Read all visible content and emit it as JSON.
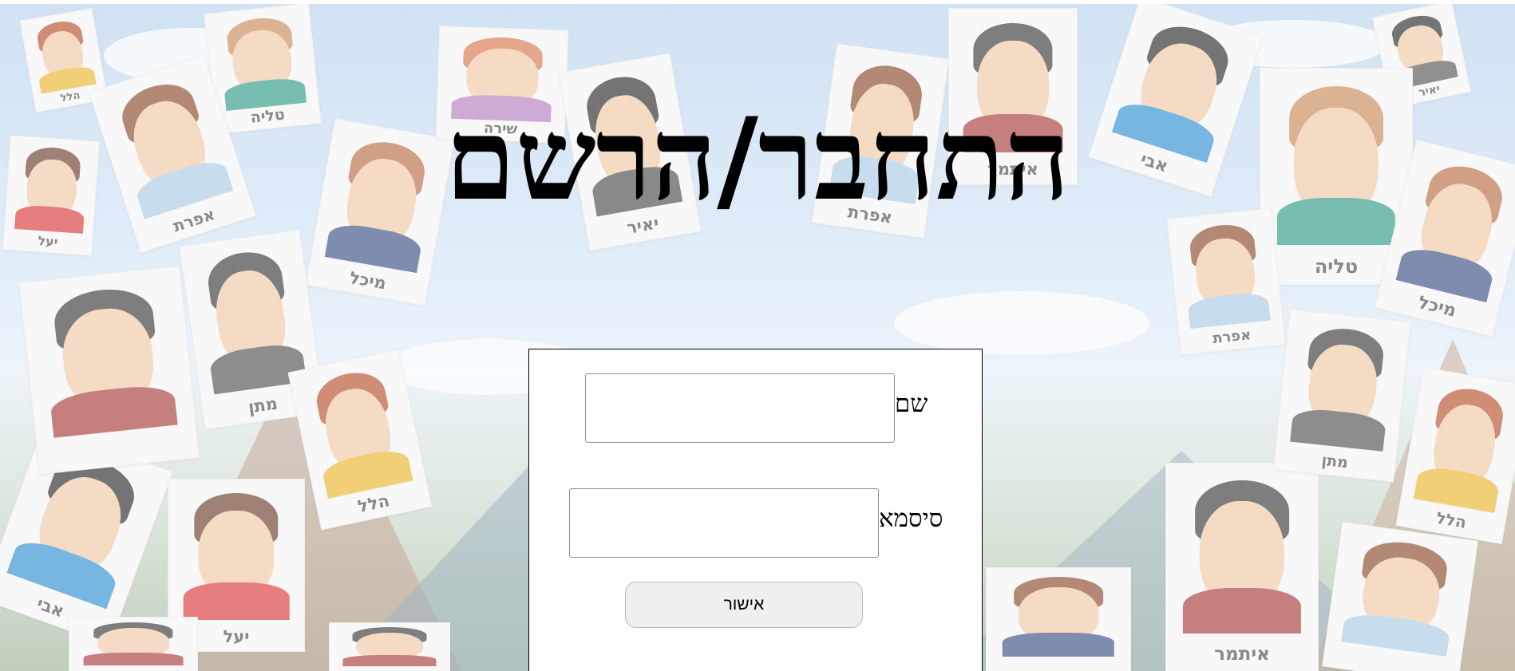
{
  "page": {
    "title": "התחבר/הרשם"
  },
  "form": {
    "name_label": "שם",
    "name_value": "",
    "password_label": "סיסמא",
    "password_value": "",
    "submit_label": "אישור"
  },
  "background": {
    "cards": [
      {
        "name": "הלל",
        "hair": "#b5512d",
        "shirt": "#e8b52f"
      },
      {
        "name": "טליה",
        "hair": "#c88a5a",
        "shirt": "#2e9a86"
      },
      {
        "name": "יעל",
        "hair": "#6b3e2a",
        "shirt": "#d9383a"
      },
      {
        "name": "אפרת",
        "hair": "#8a4b2b",
        "shirt": "#a9c9e3"
      },
      {
        "name": "מיכל",
        "hair": "#b86b45",
        "shirt": "#3a4f86"
      },
      {
        "name": "שירה",
        "hair": "#d9774e",
        "shirt": "#b27fbf"
      },
      {
        "name": "יאיר",
        "hair": "#2a2a2a",
        "shirt": "#4a4a4a"
      },
      {
        "name": "אפרת",
        "hair": "#8a4b2b",
        "shirt": "#a9c9e3"
      },
      {
        "name": "איתמר",
        "hair": "#3a3a3a",
        "shirt": "#a83b3b"
      },
      {
        "name": "אבי",
        "hair": "#2a2a2a",
        "shirt": "#2f8fd0"
      },
      {
        "name": "יאיר",
        "hair": "#2a2a2a",
        "shirt": "#555555"
      },
      {
        "name": "טליה",
        "hair": "#c88a5a",
        "shirt": "#2e9a86"
      },
      {
        "name": "מיכל",
        "hair": "#b86b45",
        "shirt": "#3a4f86"
      },
      {
        "name": "אפרת",
        "hair": "#8a4b2b",
        "shirt": "#a9c9e3"
      },
      {
        "name": "מתן",
        "hair": "#3a3a3a",
        "shirt": "#505050"
      },
      {
        "name": "הלל",
        "hair": "#b5512d",
        "shirt": "#e8b52f"
      },
      {
        "name": "איתמר",
        "hair": "#3a3a3a",
        "shirt": "#a83b3b"
      },
      {
        "name": "מתן",
        "hair": "#3a3a3a",
        "shirt": "#505050"
      },
      {
        "name": "הלל",
        "hair": "#b5512d",
        "shirt": "#e8b52f"
      },
      {
        "name": "אבי",
        "hair": "#2a2a2a",
        "shirt": "#2f8fd0"
      },
      {
        "name": "יעל",
        "hair": "#6b3e2a",
        "shirt": "#d9383a"
      },
      {
        "name": "",
        "hair": "#3a3a3a",
        "shirt": "#a83b3b"
      },
      {
        "name": "",
        "hair": "#8a4b2b",
        "shirt": "#3a4f86"
      },
      {
        "name": "",
        "hair": "#3a3a3a",
        "shirt": "#a83b3b"
      },
      {
        "name": "",
        "hair": "#8a4b2b",
        "shirt": "#a9c9e3"
      },
      {
        "name": "",
        "hair": "#3a3a3a",
        "shirt": "#a83b3b"
      }
    ]
  }
}
